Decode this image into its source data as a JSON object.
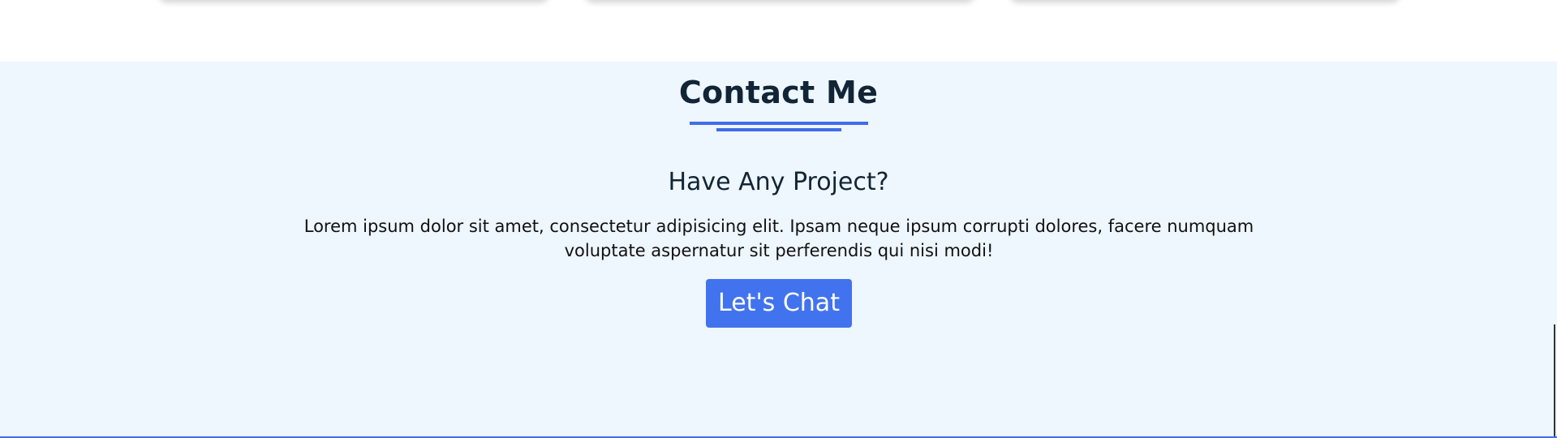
{
  "contact": {
    "title": "Contact Me",
    "subtitle": "Have Any Project?",
    "description": "Lorem ipsum dolor sit amet, consectetur adipisicing elit. Ipsam neque ipsum corrupti dolores, facere numquam voluptate aspernatur sit perferendis qui nisi modi!",
    "cta_label": "Let's Chat"
  },
  "colors": {
    "accent": "#3f6ee8",
    "button": "#4273ee",
    "section_background": "#eef6fe",
    "heading_text": "#112536"
  }
}
